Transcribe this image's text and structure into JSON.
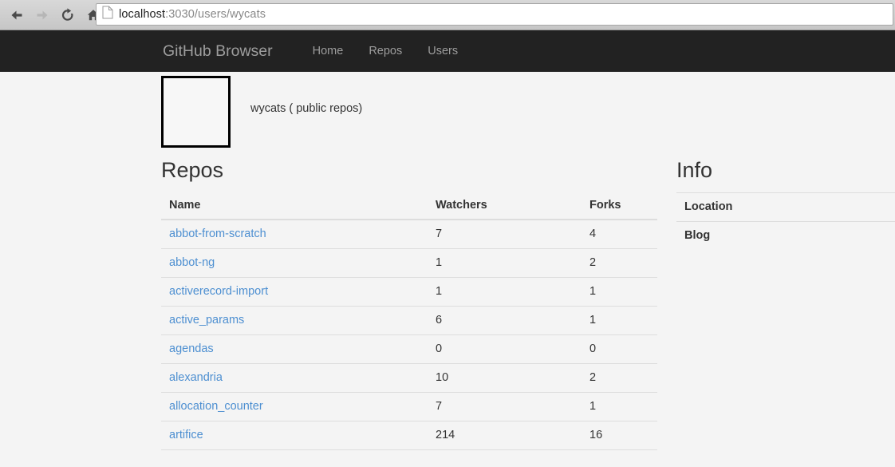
{
  "browser": {
    "back_icon": "back-arrow-icon",
    "forward_icon": "forward-arrow-icon",
    "reload_icon": "reload-icon",
    "home_icon": "home-icon",
    "page_icon": "page-document-icon",
    "url_host": "localhost",
    "url_path": ":3030/users/wycats",
    "url_full": "localhost:3030/users/wycats"
  },
  "navbar": {
    "brand": "GitHub Browser",
    "links": [
      {
        "label": "Home"
      },
      {
        "label": "Repos"
      },
      {
        "label": "Users"
      }
    ],
    "background_color": "#222222",
    "link_color": "#9d9d9d"
  },
  "user": {
    "avatar_alt": "",
    "summary": "wycats ( public repos)"
  },
  "repos": {
    "title": "Repos",
    "columns": [
      "Name",
      "Watchers",
      "Forks"
    ],
    "rows": [
      {
        "name": "abbot-from-scratch",
        "watchers": "7",
        "forks": "4"
      },
      {
        "name": "abbot-ng",
        "watchers": "1",
        "forks": "2"
      },
      {
        "name": "activerecord-import",
        "watchers": "1",
        "forks": "1"
      },
      {
        "name": "active_params",
        "watchers": "6",
        "forks": "1"
      },
      {
        "name": "agendas",
        "watchers": "0",
        "forks": "0"
      },
      {
        "name": "alexandria",
        "watchers": "10",
        "forks": "2"
      },
      {
        "name": "allocation_counter",
        "watchers": "7",
        "forks": "1"
      },
      {
        "name": "artifice",
        "watchers": "214",
        "forks": "16"
      }
    ]
  },
  "info": {
    "title": "Info",
    "rows": [
      {
        "label": "Location",
        "value": ""
      },
      {
        "label": "Blog",
        "value": ""
      }
    ]
  },
  "theme": {
    "link_color": "#4d8fd1",
    "page_background": "#f4f4f4",
    "text_color": "#333333",
    "border_color": "#dddddd"
  }
}
